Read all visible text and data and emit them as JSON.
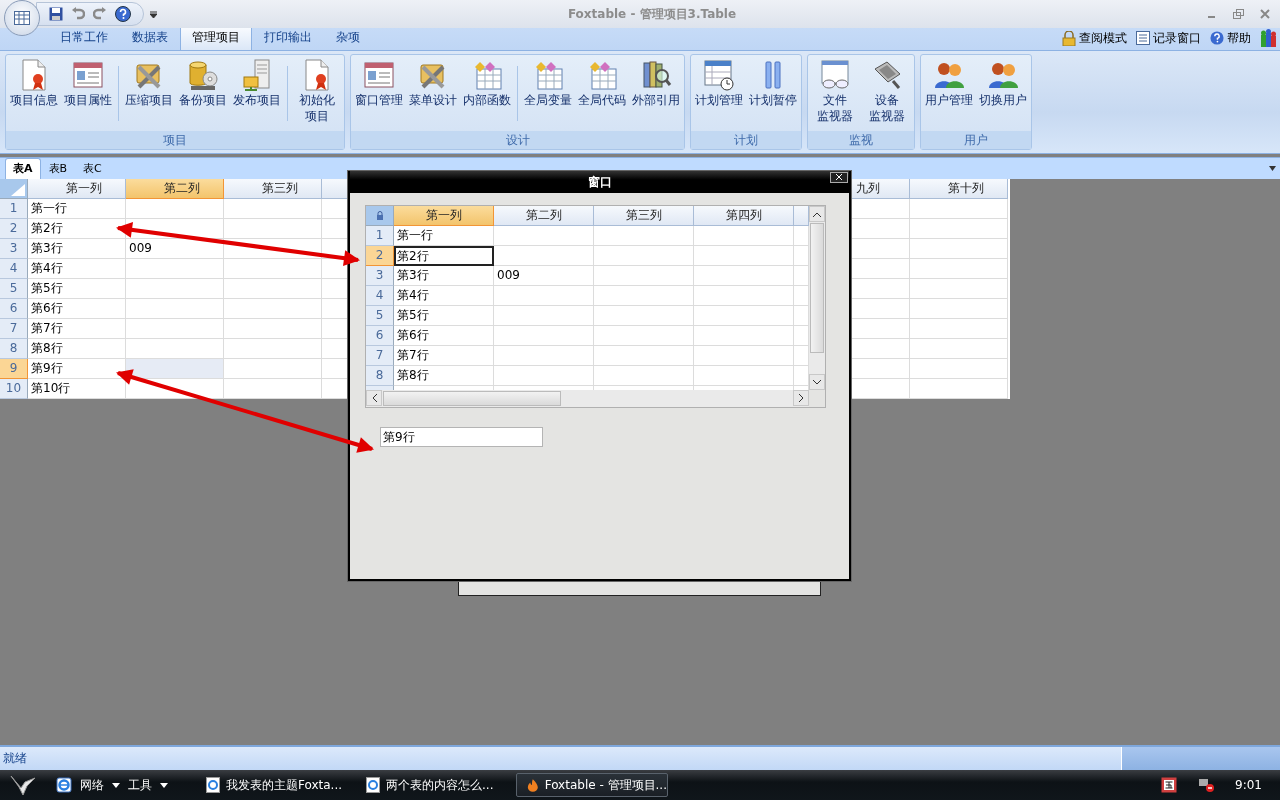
{
  "window": {
    "title": "Foxtable - 管理项目3.Table"
  },
  "ribbon_tabs": [
    {
      "label": "日常工作",
      "selected": false
    },
    {
      "label": "数据表",
      "selected": false
    },
    {
      "label": "管理项目",
      "selected": true
    },
    {
      "label": "打印输出",
      "selected": false
    },
    {
      "label": "杂项",
      "selected": false
    }
  ],
  "ribbon_links": [
    "查阅模式",
    "记录窗口",
    "帮助"
  ],
  "ribbon_groups": [
    {
      "title": "项目",
      "sections": [
        {
          "buttons": [
            {
              "lines": [
                "项目信息"
              ]
            },
            {
              "lines": [
                "项目属性"
              ]
            }
          ]
        },
        {
          "buttons": [
            {
              "lines": [
                "压缩项目"
              ]
            },
            {
              "lines": [
                "备份项目"
              ]
            },
            {
              "lines": [
                "发布项目"
              ]
            }
          ]
        },
        {
          "buttons": [
            {
              "lines": [
                "初始化",
                "项目"
              ]
            }
          ]
        }
      ]
    },
    {
      "title": "设计",
      "sections": [
        {
          "buttons": [
            {
              "lines": [
                "窗口管理"
              ]
            },
            {
              "lines": [
                "菜单设计"
              ]
            },
            {
              "lines": [
                "内部函数"
              ]
            }
          ]
        },
        {
          "buttons": [
            {
              "lines": [
                "全局变量"
              ]
            },
            {
              "lines": [
                "全局代码"
              ]
            },
            {
              "lines": [
                "外部引用"
              ]
            }
          ]
        }
      ]
    },
    {
      "title": "计划",
      "sections": [
        {
          "buttons": [
            {
              "lines": [
                "计划管理"
              ]
            },
            {
              "lines": [
                "计划暂停"
              ]
            }
          ]
        }
      ]
    },
    {
      "title": "监视",
      "sections": [
        {
          "buttons": [
            {
              "lines": [
                "文件",
                "监视器"
              ]
            },
            {
              "lines": [
                "设备",
                "监视器"
              ]
            }
          ]
        }
      ]
    },
    {
      "title": "用户",
      "sections": [
        {
          "buttons": [
            {
              "lines": [
                "用户管理"
              ]
            },
            {
              "lines": [
                "切换用户"
              ]
            }
          ]
        }
      ]
    }
  ],
  "sheet_tabs": [
    {
      "label": "表A",
      "selected": true
    },
    {
      "label": "表B",
      "selected": false
    },
    {
      "label": "表C",
      "selected": false
    }
  ],
  "grid": {
    "columns": [
      {
        "label": "第一列",
        "selected": false
      },
      {
        "label": "第二列",
        "selected": true
      },
      {
        "label": "第三列",
        "selected": false
      },
      {
        "selected": false
      },
      {},
      {},
      {},
      {},
      {
        "label": "九列",
        "selected": false
      },
      {
        "label": "第十列",
        "selected": false
      }
    ],
    "rows": [
      {
        "header": "1",
        "selected": false,
        "cells": [
          "第一行"
        ]
      },
      {
        "header": "2",
        "selected": false,
        "cells": [
          "第2行"
        ]
      },
      {
        "header": "3",
        "selected": false,
        "cells": [
          "第3行",
          "009"
        ]
      },
      {
        "header": "4",
        "selected": false,
        "cells": [
          "第4行"
        ]
      },
      {
        "header": "5",
        "selected": false,
        "cells": [
          "第5行"
        ]
      },
      {
        "header": "6",
        "selected": false,
        "cells": [
          "第6行"
        ]
      },
      {
        "header": "7",
        "selected": false,
        "cells": [
          "第7行"
        ]
      },
      {
        "header": "8",
        "selected": false,
        "cells": [
          "第8行"
        ]
      },
      {
        "header": "9",
        "selected": true,
        "cells": [
          "第9行"
        ]
      },
      {
        "header": "10",
        "selected": false,
        "cells": [
          "第10行"
        ]
      }
    ]
  },
  "dialog": {
    "title": "窗口",
    "grid": {
      "columns": [
        {
          "label": "第一列",
          "selected": true
        },
        {
          "label": "第二列",
          "selected": false
        },
        {
          "label": "第三列",
          "selected": false
        },
        {
          "label": "第四列",
          "selected": false
        }
      ],
      "rows": [
        {
          "header": "1",
          "selected": false,
          "cells": [
            "第一行"
          ]
        },
        {
          "header": "2",
          "selected": true,
          "cells": [
            "第2行"
          ]
        },
        {
          "header": "3",
          "selected": false,
          "cells": [
            "第3行",
            "009"
          ]
        },
        {
          "header": "4",
          "selected": false,
          "cells": [
            "第4行"
          ]
        },
        {
          "header": "5",
          "selected": false,
          "cells": [
            "第5行"
          ]
        },
        {
          "header": "6",
          "selected": false,
          "cells": [
            "第6行"
          ]
        },
        {
          "header": "7",
          "selected": false,
          "cells": [
            "第7行"
          ]
        },
        {
          "header": "8",
          "selected": false,
          "cells": [
            "第8行"
          ]
        }
      ]
    },
    "textbox": {
      "value": "第9行"
    }
  },
  "status_bar": {
    "text": "就绪"
  },
  "taskbar": {
    "toolbars": [
      "网络",
      "工具"
    ],
    "tasks": [
      {
        "label": "我发表的主题Foxta...",
        "selected": false
      },
      {
        "label": "两个表的内容怎么...",
        "selected": false
      },
      {
        "label": "Foxtable - 管理项目...",
        "selected": true
      }
    ],
    "clock": "9:01"
  }
}
